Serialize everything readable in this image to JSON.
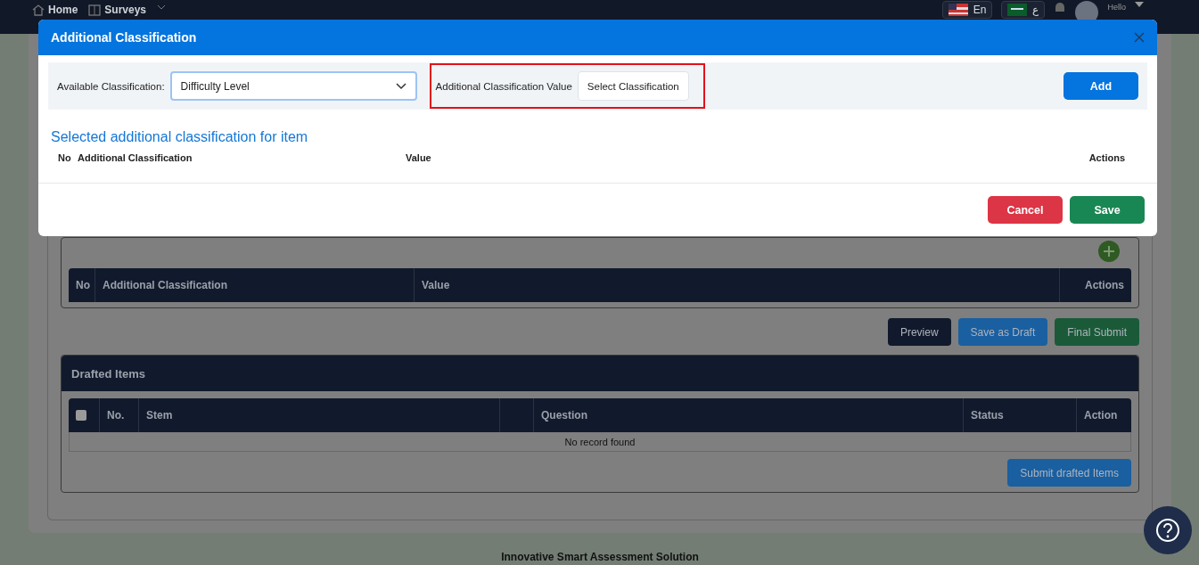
{
  "nav": {
    "items": [
      {
        "label": "Home",
        "kind": "home"
      },
      {
        "label": "Surveys",
        "kind": "surveys"
      }
    ],
    "languages": [
      {
        "label": "En",
        "kind": "us"
      },
      {
        "label": "ع",
        "kind": "sa"
      }
    ],
    "greeting": "Hello"
  },
  "modal": {
    "title": "Additional Classification",
    "available_label": "Available Classification:",
    "available_value": "Difficulty Level",
    "value_label": "Additional Classification Value",
    "value_button": "Select Classification",
    "add_button": "Add",
    "section_title": "Selected additional classification for item",
    "columns": [
      "No",
      "Additional Classification",
      "Value",
      "Actions"
    ],
    "cancel": "Cancel",
    "save": "Save"
  },
  "classification_table": {
    "columns": [
      "No",
      "Additional Classification",
      "Value",
      "Actions"
    ]
  },
  "actions": [
    "Preview",
    "Save as Draft",
    "Final Submit"
  ],
  "drafted": {
    "title": "Drafted Items",
    "select_all": {
      "checked": false
    },
    "columns": [
      "No.",
      "Stem",
      "Question",
      "Status",
      "Action"
    ],
    "empty": "No record found",
    "submit": "Submit drafted Items"
  },
  "footer": "Innovative Smart Assessment Solution"
}
